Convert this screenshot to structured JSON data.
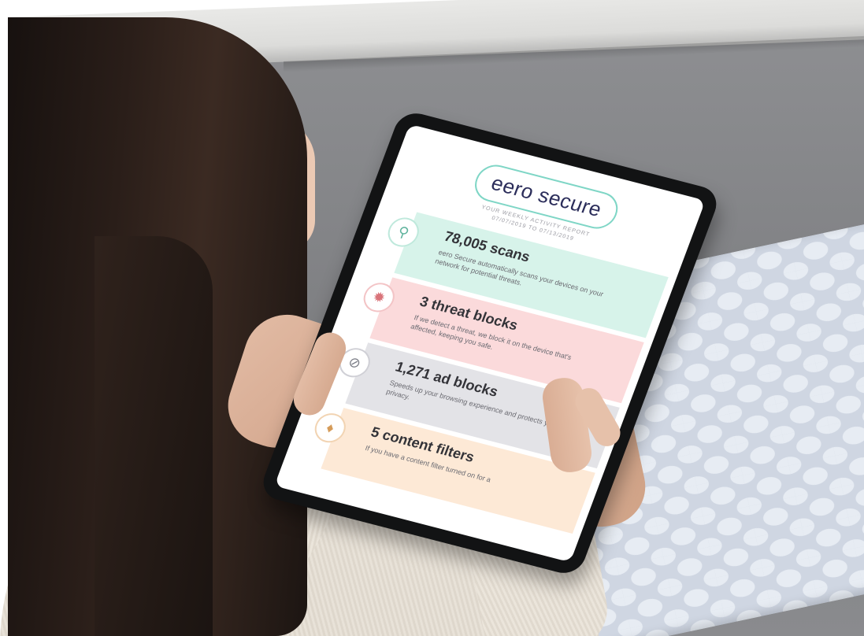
{
  "photo": {
    "subject": "",
    "tablet_screen": {
      "logo": "eero secure",
      "report_title": "YOUR WEEKLY ACTIVITY REPORT",
      "report_dates": "07/07/2019 TO 07/13/2019",
      "cards": [
        {
          "stat": "78,005 scans",
          "description": "eero Secure automatically scans your devices on your network for potential threats.",
          "icon": "magnifier-icon",
          "color": "#d7f3ea"
        },
        {
          "stat": "3 threat blocks",
          "description": "If we detect a threat, we block it on the device that's affected, keeping you safe.",
          "icon": "bug-icon",
          "color": "#fbdadb"
        },
        {
          "stat": "1,271 ad blocks",
          "description": "Speeds up your browsing experience and protects your privacy.",
          "icon": "block-icon",
          "color": "#e3e3e7"
        },
        {
          "stat": "5 content filters",
          "description": "If you have a content filter turned on for a",
          "icon": "shield-icon",
          "color": "#fde9d6"
        }
      ]
    }
  }
}
